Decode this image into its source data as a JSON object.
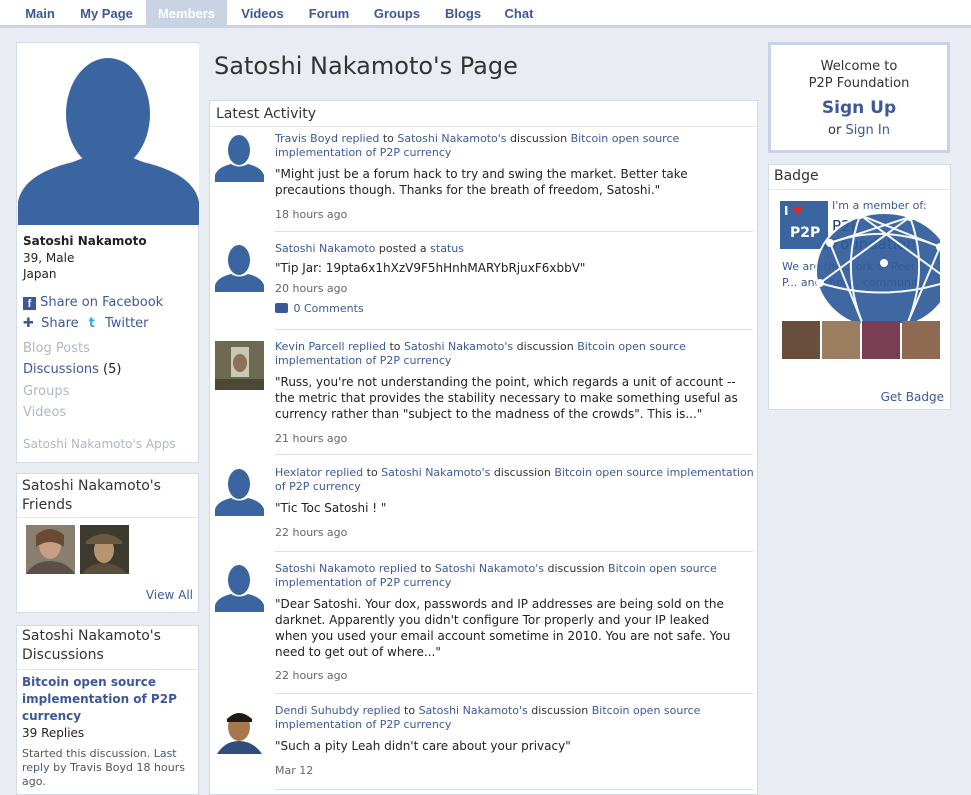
{
  "nav": {
    "tabs": [
      {
        "label": "Main"
      },
      {
        "label": "My Page"
      },
      {
        "label": "Members"
      },
      {
        "label": "Videos"
      },
      {
        "label": "Forum"
      },
      {
        "label": "Groups"
      },
      {
        "label": "Blogs"
      },
      {
        "label": "Chat"
      }
    ],
    "active": "Members"
  },
  "profile": {
    "name": "Satoshi Nakamoto",
    "age_sex": "39, Male",
    "location": "Japan",
    "share_facebook": "Share on Facebook",
    "share": "Share",
    "twitter": "Twitter",
    "links": {
      "blog_posts": "Blog Posts",
      "discussions": "Discussions",
      "discussions_count": "(5)",
      "groups": "Groups",
      "videos": "Videos",
      "apps": "Satoshi Nakamoto's Apps"
    }
  },
  "friends": {
    "title": "Satoshi Nakamoto's Friends",
    "view_all": "View All"
  },
  "discussions": {
    "title": "Satoshi Nakamoto's Discussions",
    "topic": "Bitcoin open source implementation of P2P currency",
    "replies": "39 Replies",
    "started": "Started this discussion.",
    "last_reply": "Last reply",
    "by": "by Travis Boyd 18 hours ago."
  },
  "page_title": "Satoshi Nakamoto's Page",
  "activity": {
    "title": "Latest Activity",
    "comments_label": "0 Comments",
    "items": [
      {
        "actor": "Travis Boyd",
        "verb": "replied",
        "mid": "to",
        "target": "Satoshi Nakamoto's",
        "kind": "discussion",
        "subject": "Bitcoin open source implementation of P2P currency",
        "quote": "\"Might just be a forum hack to try and swing the market.  Better take precautions though.  Thanks for the breath of freedom, Satoshi.\"",
        "time": "18 hours ago"
      },
      {
        "actor": "Satoshi Nakamoto",
        "verb": "posted a",
        "kind": "status",
        "quote": "\"Tip Jar: 19pta6x1hXzV9F5hHnhMARYbRjuxF6xbbV\"",
        "time": "20 hours ago"
      },
      {
        "actor": "Kevin Parcell",
        "verb": "replied",
        "mid": "to",
        "target": "Satoshi Nakamoto's",
        "kind": "discussion",
        "subject": "Bitcoin open source implementation of P2P currency",
        "quote": "\"Russ, you're not understanding the point, which regards a unit of account -- the metric that provides the stability necessary to make something useful as currency rather than \"subject to the madness of the crowds\".  This is...\"",
        "time": "21 hours ago"
      },
      {
        "actor": "Hexlator",
        "verb": "replied",
        "mid": "to",
        "target": "Satoshi Nakamoto's",
        "kind": "discussion",
        "subject": "Bitcoin open source implementation of P2P currency",
        "quote": "\"Tic Toc Satoshi ! \"",
        "time": "22 hours ago"
      },
      {
        "actor": "Satoshi Nakamoto",
        "verb": "replied",
        "mid": "to",
        "target": "Satoshi Nakamoto's",
        "kind": "discussion",
        "subject": "Bitcoin open source implementation of P2P currency",
        "quote": "\"Dear Satoshi. Your dox, passwords and IP addresses are being sold on the darknet. Apparently you didn't configure Tor properly and your IP leaked when you used your email account sometime in 2010. You are not safe. You need to get out of where...\"",
        "time": "22 hours ago"
      },
      {
        "actor": "Dendi Suhubdy",
        "verb": "replied",
        "mid": "to",
        "target": "Satoshi Nakamoto's",
        "kind": "discussion",
        "subject": "Bitcoin open source implementation of P2P currency",
        "quote": "\"Such a pity Leah didn't care about your privacy\"",
        "time": "Mar 12"
      }
    ]
  },
  "welcome": {
    "line1": "Welcome to",
    "line2": "P2P Foundation",
    "signup": "Sign Up",
    "or": "or",
    "signin": "Sign In"
  },
  "badge": {
    "title": "Badge",
    "member_of": "I'm a member of:",
    "org": "P2P Foundation",
    "mini_logo": "P2P",
    "desc": "We are the ...ork of Peer to P... and thos... community",
    "get_badge": "Get Badge"
  },
  "colors": {
    "link": "#3b5998",
    "nav_active_bg": "#c9d3e3",
    "page_bg": "#e9ecf2",
    "silhouette": "#3a65a0"
  }
}
